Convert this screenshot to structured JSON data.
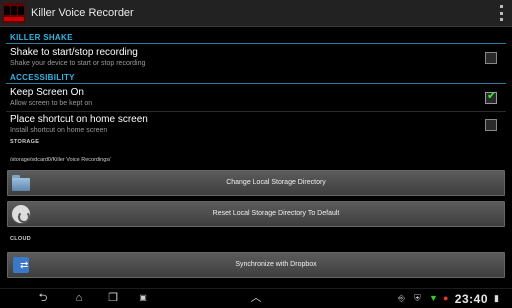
{
  "app": {
    "title": "Killer Voice Recorder"
  },
  "sections": {
    "killer_shake": "KILLER SHAKE",
    "accessibility": "ACCESSIBILITY",
    "storage": "STORAGE",
    "cloud": "CLOUD"
  },
  "prefs": {
    "shake": {
      "title": "Shake to start/stop recording",
      "summary": "Shake your device to start or stop recording",
      "checked": false
    },
    "keep_screen": {
      "title": "Keep Screen On",
      "summary": "Allow screen to be kept on",
      "checked": true
    },
    "shortcut": {
      "title": "Place shortcut on home screen",
      "summary": "Install shortcut on home screen",
      "checked": false
    }
  },
  "storage_path": "/storage/sdcard0/Killer Voice Recordings/",
  "buttons": {
    "change_dir": "Change Local Storage Directory",
    "reset_dir": "Reset Local Storage Directory To Default",
    "dropbox": "Synchronize with Dropbox"
  },
  "status": {
    "time": "23:40"
  },
  "icons": {
    "app": "killer-voice-recorder-icon",
    "overflow": "overflow-menu-icon",
    "folder": "folder-icon",
    "reset": "reset-icon",
    "dropbox": "dropbox-icon",
    "back": "back-icon",
    "home": "home-icon",
    "recent": "recent-apps-icon",
    "screenshot": "screenshot-icon",
    "up": "chevron-up-icon",
    "usb": "usb-icon",
    "security": "shield-icon",
    "record": "record-icon",
    "wifi": "wifi-icon",
    "battery": "battery-icon"
  },
  "colors": {
    "accent": "#33b5e5",
    "check": "#33ee33"
  }
}
